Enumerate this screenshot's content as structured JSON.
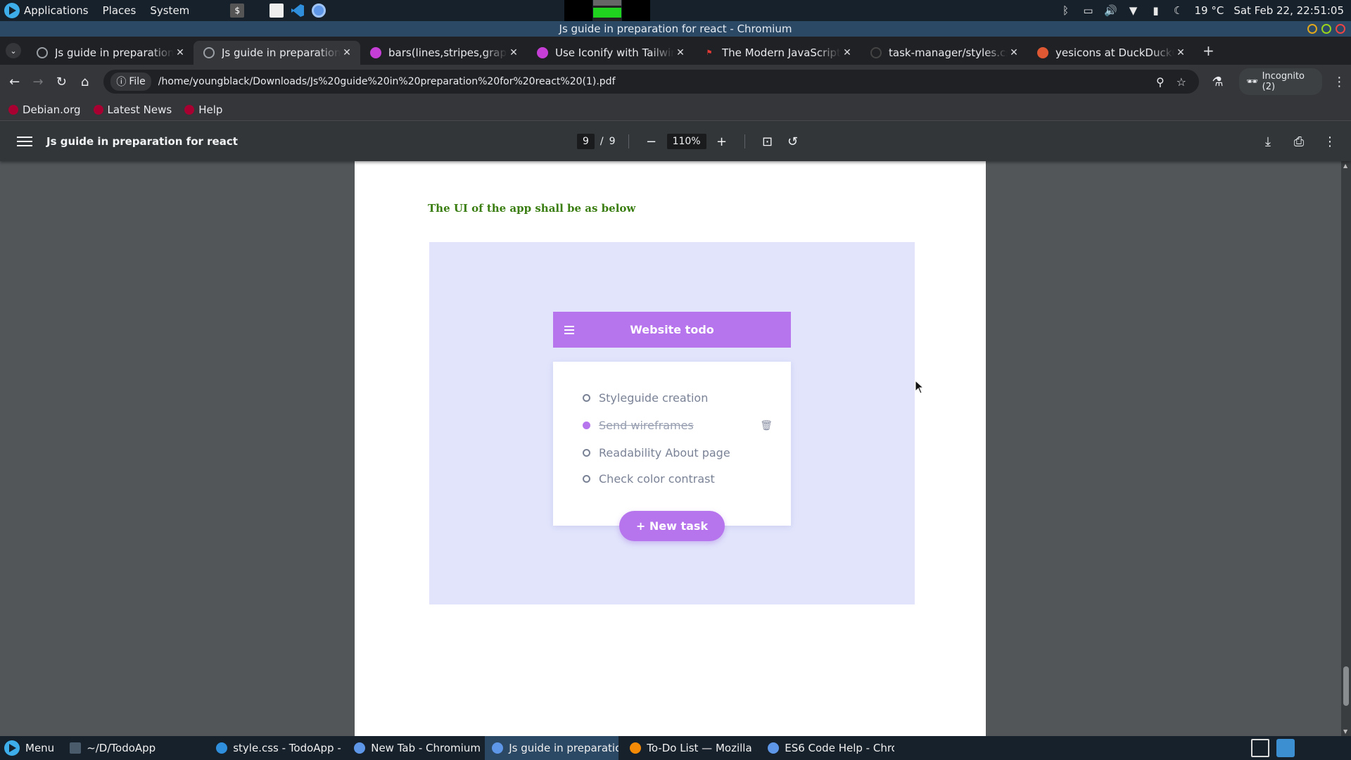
{
  "os_panel": {
    "menus": [
      "Applications",
      "Places",
      "System"
    ],
    "weather": "19 °C",
    "clock": "Sat Feb 22, 22:51:05"
  },
  "window": {
    "title": "Js guide in preparation for react - Chromium"
  },
  "tabs": [
    {
      "label": "Js guide in preparation for react",
      "favicon": "globe-icon",
      "active": false
    },
    {
      "label": "Js guide in preparation for react",
      "favicon": "globe-icon",
      "active": true
    },
    {
      "label": "bars(lines,stripes,graph,chart)",
      "favicon": "iconify-icon",
      "active": false
    },
    {
      "label": "Use Iconify with Tailwind CSS",
      "favicon": "iconify-icon",
      "active": false
    },
    {
      "label": "The Modern JavaScript Tutorial",
      "favicon": "js-icon",
      "active": false
    },
    {
      "label": "task-manager/styles.css",
      "favicon": "github-icon",
      "active": false
    },
    {
      "label": "yesicons at DuckDuckGo",
      "favicon": "duckduckgo-icon",
      "active": false
    }
  ],
  "toolbar": {
    "site_chip": "File",
    "url": "/home/youngblack/Downloads/Js%20guide%20in%20preparation%20for%20react%20(1).pdf",
    "incognito": "Incognito (2)"
  },
  "bookmarks": [
    "Debian.org",
    "Latest News",
    "Help"
  ],
  "pdf": {
    "title": "Js guide in preparation for react",
    "page_current": "9",
    "page_separator": "/",
    "page_total": "9",
    "zoom": "110%",
    "heading": "The UI of the app shall be as below",
    "mockup": {
      "header_title": "Website todo",
      "tasks": [
        {
          "label": "Styleguide creation",
          "done": false
        },
        {
          "label": "Send wireframes",
          "done": true
        },
        {
          "label": "Readability About page",
          "done": false
        },
        {
          "label": "Check color contrast",
          "done": false
        }
      ],
      "new_task_label": "+ New task"
    }
  },
  "taskbar": {
    "menu_label": "Menu",
    "items": [
      {
        "label": "~/D/TodoApp",
        "active": false
      },
      {
        "label": "style.css - TodoApp - ...",
        "active": false
      },
      {
        "label": "New Tab - Chromium",
        "active": false
      },
      {
        "label": "Js guide in preparatio...",
        "active": true
      },
      {
        "label": "To-Do List — Mozilla ...",
        "active": false
      },
      {
        "label": "ES6 Code Help - Chro...",
        "active": false
      }
    ]
  },
  "colors": {
    "mockup_purple": "#b675ed",
    "mockup_background": "#e1e4fb",
    "heading_green": "#3a7d11",
    "panel_bg": "#17212b"
  }
}
